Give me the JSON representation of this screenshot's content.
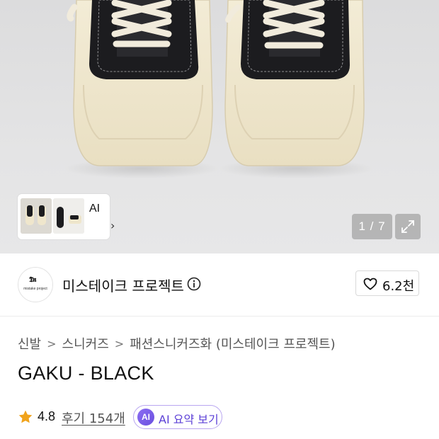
{
  "gallery": {
    "counter": "1 / 7",
    "thumbnail_ai_label": "AI",
    "thumbnail_ai_chevron": "›"
  },
  "brand": {
    "logo_text": "𝕿𝖓",
    "logo_subtext": "mistake project",
    "name": "미스테이크 프로젝트",
    "like_count": "6.2천"
  },
  "breadcrumb": {
    "items": [
      "신발",
      "스니커즈",
      "패션스니커즈화 (미스테이크 프로젝트)"
    ],
    "separator": ">"
  },
  "product": {
    "title": "GAKU - BLACK"
  },
  "rating": {
    "value": "4.8",
    "review_link": "후기 154개",
    "ai_badge": "AI",
    "ai_summary_label": "AI 요약 보기"
  },
  "colors": {
    "accent_purple": "#6a4fe0",
    "star": "#f0a31c",
    "sole_cream": "#efe6cc",
    "upper_black": "#1c1c1f"
  },
  "icons": [
    "info-icon",
    "heart-icon",
    "expand-icon",
    "star-icon",
    "chevron-right-icon"
  ]
}
